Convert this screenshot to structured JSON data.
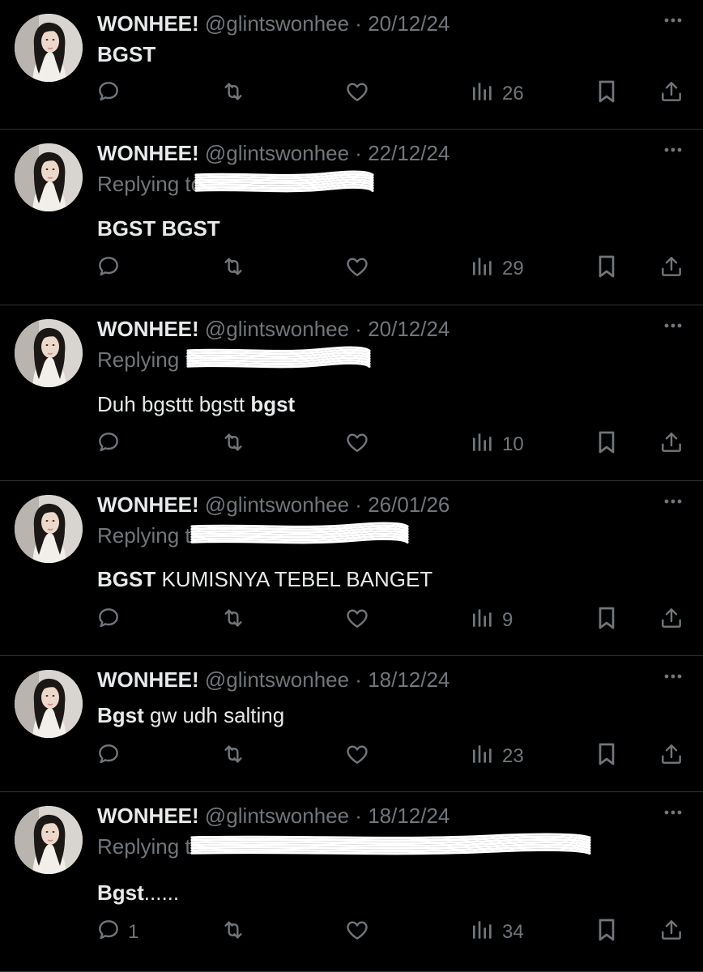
{
  "tweets": [
    {
      "name": "WONHEE!",
      "handle": "@glintswonhee",
      "sep": "·",
      "date": "20/12/24",
      "replying": "",
      "body": [
        {
          "t": "BGST",
          "b": true
        }
      ],
      "reply_count": "",
      "views": "26"
    },
    {
      "name": "WONHEE!",
      "handle": "@glintswonhee",
      "sep": "·",
      "date": "22/12/24",
      "replying": "Replying to",
      "body": [
        {
          "t": "BGST BGST",
          "b": true
        }
      ],
      "reply_count": "",
      "views": "29"
    },
    {
      "name": "WONHEE!",
      "handle": "@glintswonhee",
      "sep": "·",
      "date": "20/12/24",
      "replying": "Replying to",
      "body": [
        {
          "t": "Duh bgsttt bgstt ",
          "b": false
        },
        {
          "t": "bgst",
          "b": true
        }
      ],
      "reply_count": "",
      "views": "10"
    },
    {
      "name": "WONHEE!",
      "handle": "@glintswonhee",
      "sep": "·",
      "date": "26/01/26",
      "replying": "Replying to",
      "body": [
        {
          "t": "BGST",
          "b": true
        },
        {
          "t": " KUMISNYA TEBEL BANGET",
          "b": false
        }
      ],
      "reply_count": "",
      "views": "9"
    },
    {
      "name": "WONHEE!",
      "handle": "@glintswonhee",
      "sep": "·",
      "date": "18/12/24",
      "replying": "",
      "body": [
        {
          "t": "Bgst",
          "b": true
        },
        {
          "t": " gw udh salting",
          "b": false
        }
      ],
      "reply_count": "",
      "views": "23"
    },
    {
      "name": "WONHEE!",
      "handle": "@glintswonhee",
      "sep": "·",
      "date": "18/12/24",
      "replying": "Replying to",
      "body": [
        {
          "t": "Bgst",
          "b": true
        },
        {
          "t": "......",
          "b": false
        }
      ],
      "reply_count": "1",
      "views": "34"
    }
  ],
  "icons": {
    "reply": "reply-icon",
    "retweet": "retweet-icon",
    "like": "heart-icon",
    "views": "views-icon",
    "bookmark": "bookmark-icon",
    "share": "share-icon",
    "more": "more-icon"
  },
  "colors": {
    "background": "#000000",
    "text": "#e7e9ea",
    "muted": "#71767b",
    "divider": "#2f3336"
  }
}
